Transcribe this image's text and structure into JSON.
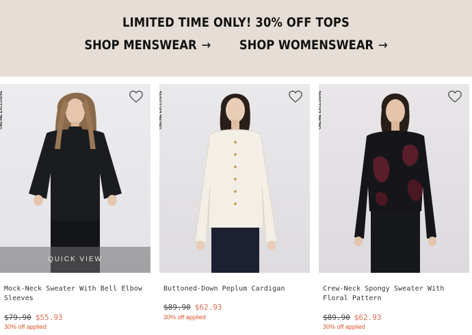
{
  "banner": {
    "headline": "LIMITED TIME ONLY! 30% OFF TOPS",
    "links": [
      {
        "label": "SHOP MENSWEAR",
        "arrow": "→"
      },
      {
        "label": "SHOP WOMENSWEAR",
        "arrow": "→"
      }
    ]
  },
  "products": [
    {
      "tag": "ONLINE EXCLUSIVE",
      "title": "Mock-Neck Sweater With Bell Elbow Sleeves",
      "price_original": "$79.90",
      "price_sale": "$55.93",
      "discount": "30% off applied",
      "quick_view": "QUICK VIEW",
      "colors": {
        "garment": "#1b1c20",
        "hair": "#8a6a4a"
      }
    },
    {
      "tag": "ONLINE EXCLUSIVE",
      "title": "Buttoned-Down Peplum Cardigan",
      "price_original": "$89.90",
      "price_sale": "$62.93",
      "discount": "30% off applied",
      "colors": {
        "garment": "#f3efe6",
        "hair": "#2a1f18"
      }
    },
    {
      "tag": "ONLINE EXCLUSIVE",
      "title": "Crew-Neck Spongy Sweater With Floral Pattern",
      "price_original": "$89.90",
      "price_sale": "$62.93",
      "discount": "30% off applied",
      "colors": {
        "garment": "#16161a",
        "pattern": "#5a1e2a",
        "hair": "#2a1f18"
      }
    }
  ],
  "icons": {
    "wishlist": "heart-outline-icon",
    "arrow": "arrow-right-icon"
  }
}
